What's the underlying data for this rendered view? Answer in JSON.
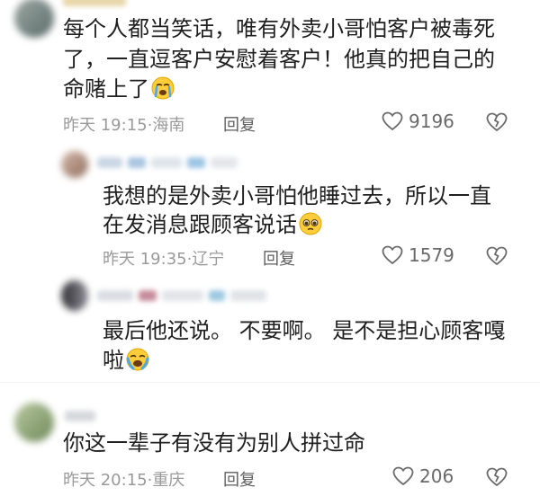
{
  "comments": [
    {
      "line1": "每个人都当笑话，唯有外卖小哥怕客户被毒死",
      "line2": "了，一直逗客户安慰着客户！他真的把自己的",
      "line3": "命赌上了",
      "emoji": "crying-face",
      "time": "昨天 19:15",
      "location": "海南",
      "reply_label": "回复",
      "likes": "9196"
    },
    {
      "line1": "我想的是外卖小哥怕他睡过去，所以一直",
      "line2": "在发消息跟顾客说话",
      "emoji": "pleading-face",
      "time": "昨天 19:35",
      "location": "辽宁",
      "reply_label": "回复",
      "likes": "1579"
    },
    {
      "line1": "最后他还说。 不要啊。 是不是担心顾客嘎",
      "line2": "啦",
      "emoji": "loudly-crying-face"
    },
    {
      "line1": "你这一辈子有没有为别人拼过命",
      "time": "昨天 20:15",
      "location": "重庆",
      "reply_label": "回复",
      "likes": "206"
    }
  ],
  "colors": {
    "text": "#1f1f1f",
    "meta": "#9a9a9a",
    "icon": "#6a6a6a"
  }
}
